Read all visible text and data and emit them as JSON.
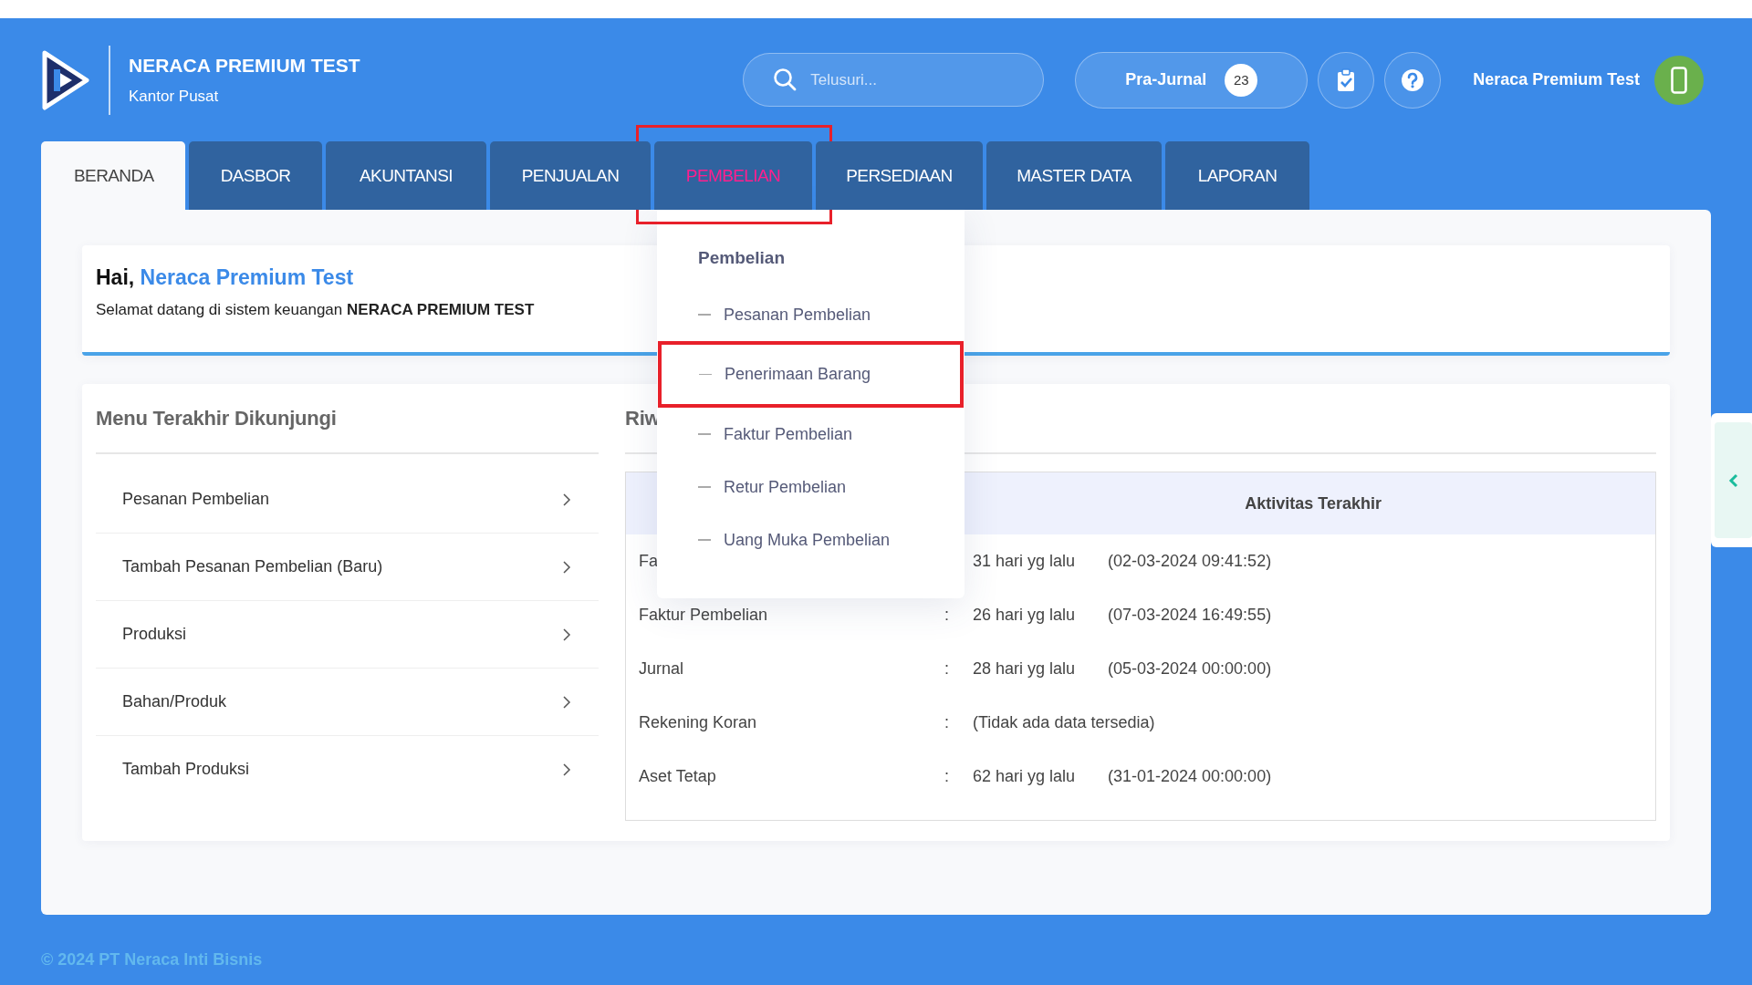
{
  "brand": {
    "title": "NERACA PREMIUM TEST",
    "subtitle": "Kantor Pusat"
  },
  "search": {
    "placeholder": "Telusuri..."
  },
  "pre_journal": {
    "label": "Pra-Jurnal",
    "count": "23"
  },
  "user": {
    "name": "Neraca Premium Test"
  },
  "tabs": [
    {
      "label": "BERANDA",
      "selected": true,
      "open": false,
      "highlighted": false
    },
    {
      "label": "DASBOR",
      "selected": false,
      "open": false,
      "highlighted": false
    },
    {
      "label": "AKUNTANSI",
      "selected": false,
      "open": false,
      "highlighted": false
    },
    {
      "label": "PENJUALAN",
      "selected": false,
      "open": false,
      "highlighted": false
    },
    {
      "label": "PEMBELIAN",
      "selected": false,
      "open": true,
      "highlighted": true
    },
    {
      "label": "PERSEDIAAN",
      "selected": false,
      "open": false,
      "highlighted": false
    },
    {
      "label": "MASTER DATA",
      "selected": false,
      "open": false,
      "highlighted": false
    },
    {
      "label": "LAPORAN",
      "selected": false,
      "open": false,
      "highlighted": false
    }
  ],
  "dropdown": {
    "title": "Pembelian",
    "items": [
      {
        "label": "Pesanan Pembelian",
        "highlighted": false
      },
      {
        "label": "Penerimaan Barang",
        "highlighted": true
      },
      {
        "label": "Faktur Pembelian",
        "highlighted": false
      },
      {
        "label": "Retur Pembelian",
        "highlighted": false
      },
      {
        "label": "Uang Muka Pembelian",
        "highlighted": false
      }
    ]
  },
  "welcome": {
    "greeting": "Hai,",
    "name": "Neraca Premium Test",
    "message": "Selamat datang di sistem keuangan **NERACA PREMIUM TEST**"
  },
  "recent_menu": {
    "title": "Menu Terakhir Dikunjungi",
    "items": [
      "Pesanan Pembelian",
      "Tambah Pesanan Pembelian (Baru)",
      "Produksi",
      "Bahan/Produk",
      "Tambah Produksi"
    ]
  },
  "activity": {
    "title": "Riw",
    "header": "Aktivitas Terakhir",
    "rows": [
      {
        "label": "Fa",
        "ago": "31 hari yg lalu",
        "date": "(02-03-2024 09:41:52)"
      },
      {
        "label": "Faktur Pembelian",
        "separator": ":",
        "ago": "26 hari yg lalu",
        "date": "(07-03-2024 16:49:55)"
      },
      {
        "label": "Jurnal",
        "separator": ":",
        "ago": "28 hari yg lalu",
        "date": "(05-03-2024 00:00:00)"
      },
      {
        "label": "Rekening Koran",
        "separator": ":",
        "ago": "(Tidak ada data tersedia)"
      },
      {
        "label": "Aset Tetap",
        "separator": ":",
        "ago": "62 hari yg lalu",
        "date": "(31-01-2024 00:00:00)"
      }
    ]
  },
  "footer": "© 2024 PT Neraca Inti Bisnis"
}
